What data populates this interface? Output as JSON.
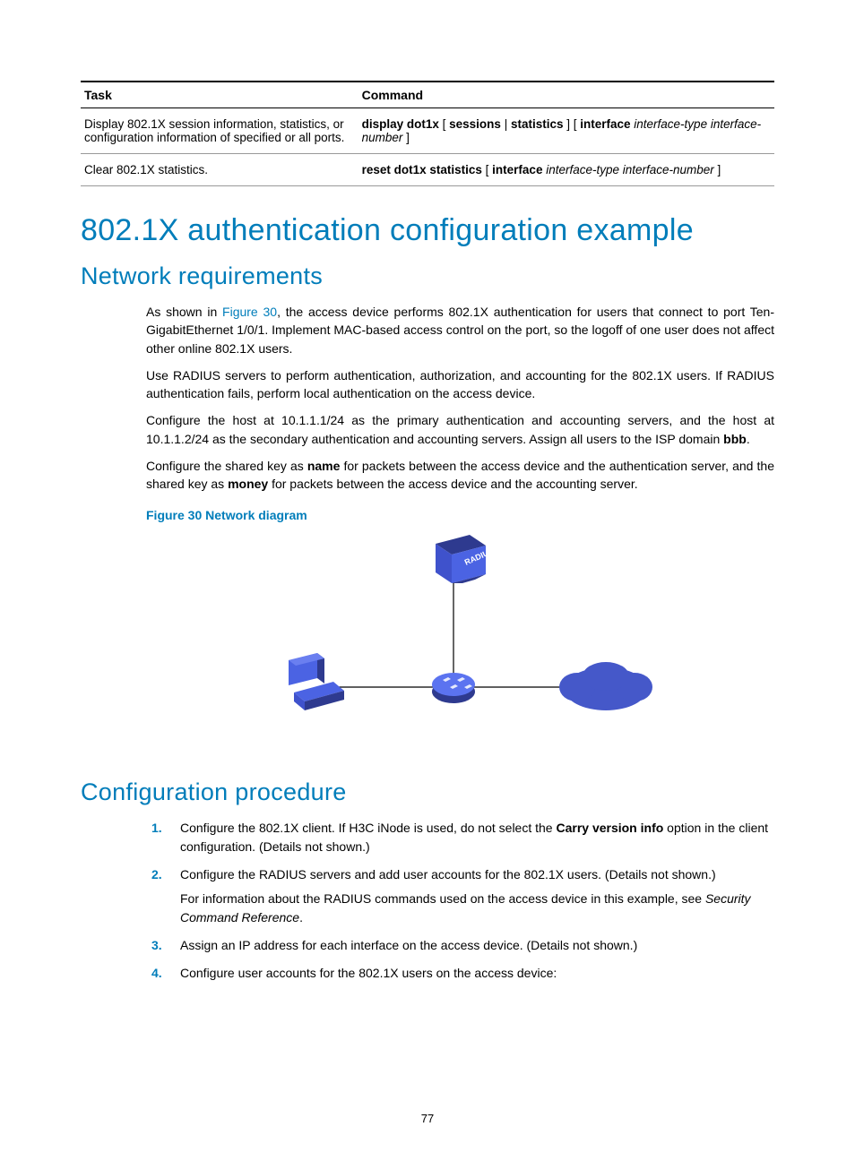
{
  "table": {
    "headers": [
      "Task",
      "Command"
    ],
    "rows": [
      {
        "task": "Display 802.1X session information, statistics, or configuration information of specified or all ports.",
        "cmd_b1": "display dot1x",
        "cmd_t1": " [ ",
        "cmd_b2": "sessions",
        "cmd_t2": " | ",
        "cmd_b3": "statistics",
        "cmd_t3": " ] [ ",
        "cmd_b4": "interface",
        "cmd_i1": " interface-type interface-number",
        "cmd_t4": " ]"
      },
      {
        "task": "Clear 802.1X statistics.",
        "cmd_b1": "reset dot1x statistics",
        "cmd_t1": " [ ",
        "cmd_b4": "interface",
        "cmd_i1": " interface-type interface-number",
        "cmd_t4": " ]"
      }
    ]
  },
  "h1": "802.1X authentication configuration example",
  "h2a": "Network requirements",
  "para1_a": "As shown in ",
  "para1_link": "Figure 30",
  "para1_b": ", the access device performs 802.1X authentication for users that connect to port Ten-GigabitEthernet 1/0/1. Implement MAC-based access control on the port, so the logoff of one user does not affect other online 802.1X users.",
  "para2": "Use RADIUS servers to perform authentication, authorization, and accounting for the 802.1X users. If RADIUS authentication fails, perform local authentication on the access device.",
  "para3_a": "Configure the host at 10.1.1.1/24 as the primary authentication and accounting servers, and the host at 10.1.1.2/24 as the secondary authentication and accounting servers. Assign all users to the ISP domain ",
  "para3_b": "bbb",
  "para3_c": ".",
  "para4_a": "Configure the shared key as ",
  "para4_b1": "name",
  "para4_b": " for packets between the access device and the authentication server, and the shared key as ",
  "para4_b2": "money",
  "para4_c": " for packets between the access device and the accounting server.",
  "fig_caption": "Figure 30 Network diagram",
  "h2b": "Configuration procedure",
  "steps": [
    {
      "a": "Configure the 802.1X client. If H3C iNode is used, do not select the ",
      "b": "Carry version info",
      "c": " option in the client configuration. (Details not shown.)"
    },
    {
      "a": "Configure the RADIUS servers and add user accounts for the 802.1X users. (Details not shown.)",
      "sub_a": "For information about the RADIUS commands used on the access device in this example, see ",
      "sub_i": "Security Command Reference",
      "sub_c": "."
    },
    {
      "a": "Assign an IP address for each interface on the access device. (Details not shown.)"
    },
    {
      "a": "Configure user accounts for the 802.1X users on the access device:"
    }
  ],
  "page_num": "77",
  "diagram": {
    "server_label": "RADIUS"
  }
}
